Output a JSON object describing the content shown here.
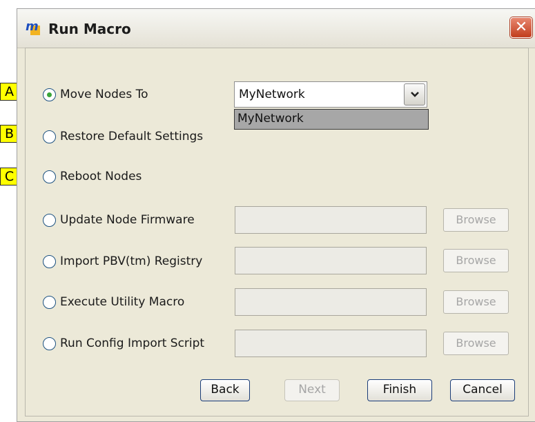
{
  "window": {
    "title": "Run Macro",
    "close_glyph": "✕"
  },
  "callouts": [
    "A",
    "B",
    "C"
  ],
  "options": [
    {
      "label": "Move Nodes To",
      "selected": true
    },
    {
      "label": "Restore Default Settings",
      "selected": false
    },
    {
      "label": "Reboot Nodes",
      "selected": false
    },
    {
      "label": "Update Node Firmware",
      "selected": false
    },
    {
      "label": "Import PBV(tm) Registry",
      "selected": false
    },
    {
      "label": "Execute Utility Macro",
      "selected": false
    },
    {
      "label": "Run Config Import Script",
      "selected": false
    }
  ],
  "network_combo": {
    "value": "MyNetwork",
    "dropdown_item": "MyNetwork"
  },
  "browse_label": "Browse",
  "buttons": {
    "back": "Back",
    "next": "Next",
    "finish": "Finish",
    "cancel": "Cancel"
  },
  "colors": {
    "radio_selected": "#3aa53a",
    "callout_bg": "#ffff00",
    "close_red": "#c13d1d"
  }
}
